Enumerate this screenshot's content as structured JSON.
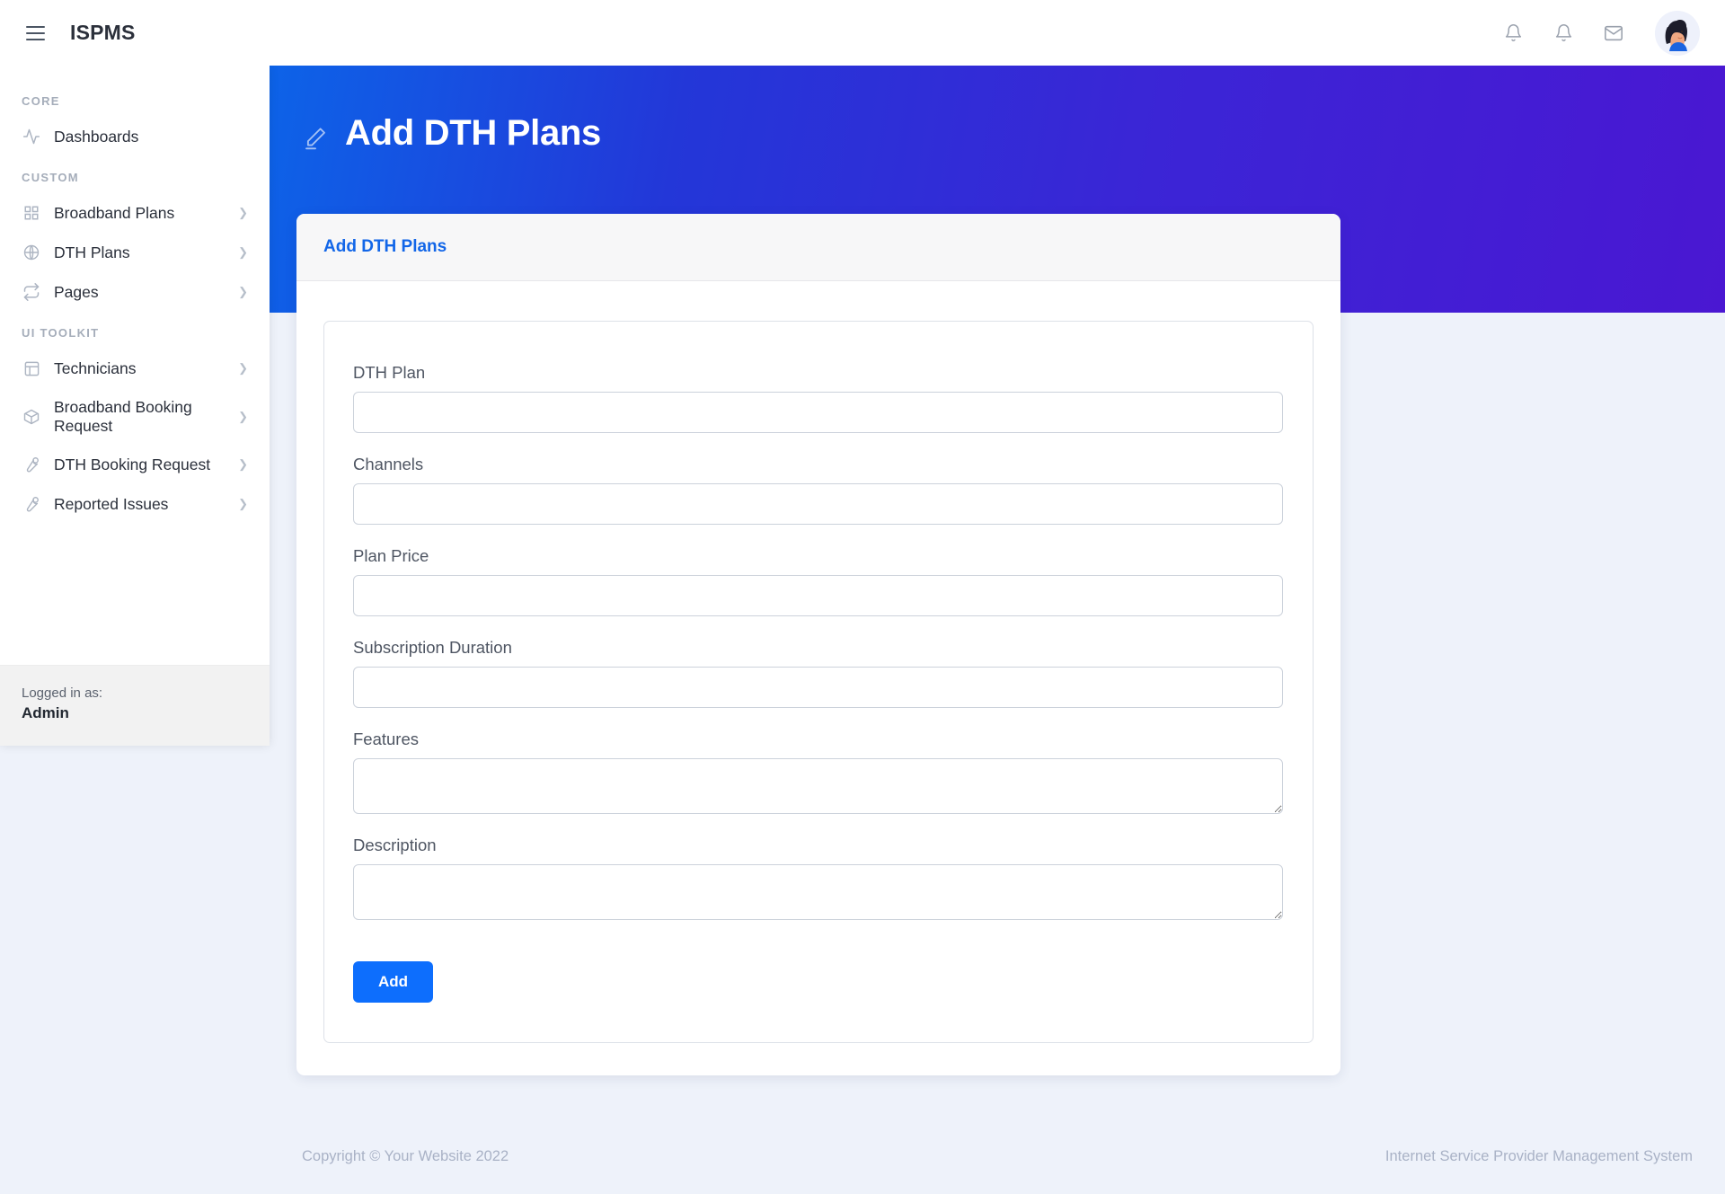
{
  "topbar": {
    "brand": "ISPMS",
    "menu_icon": "hamburger-icon",
    "icons": [
      {
        "name": "bell-icon",
        "label": "Alerts"
      },
      {
        "name": "bell-icon",
        "label": "Notifications"
      },
      {
        "name": "envelope-icon",
        "label": "Messages"
      }
    ],
    "avatar_alt": "User avatar"
  },
  "sidebar": {
    "sections": [
      {
        "heading": "CORE",
        "items": [
          {
            "label": "Dashboards",
            "icon": "activity-icon",
            "chevron": false
          }
        ]
      },
      {
        "heading": "CUSTOM",
        "items": [
          {
            "label": "Broadband Plans",
            "icon": "grid-icon",
            "chevron": true
          },
          {
            "label": "DTH Plans",
            "icon": "globe-icon",
            "chevron": true
          },
          {
            "label": "Pages",
            "icon": "repeat-icon",
            "chevron": true
          }
        ]
      },
      {
        "heading": "UI TOOLKIT",
        "items": [
          {
            "label": "Technicians",
            "icon": "layout-icon",
            "chevron": true
          },
          {
            "label": "Broadband Booking Request",
            "icon": "box-icon",
            "chevron": true
          },
          {
            "label": "DTH Booking Request",
            "icon": "wrench-icon",
            "chevron": true
          },
          {
            "label": "Reported Issues",
            "icon": "wrench-icon",
            "chevron": true
          }
        ]
      }
    ],
    "footer": {
      "logged_in_label": "Logged in as:",
      "user": "Admin"
    }
  },
  "hero": {
    "title": "Add DTH Plans",
    "icon": "pencil-icon",
    "gradient_from": "#0d63e8",
    "gradient_to": "#4a17d2"
  },
  "card": {
    "header": "Add DTH Plans",
    "fields": [
      {
        "label": "DTH Plan",
        "value": "",
        "placeholder": "",
        "type": "text",
        "name": "dth-plan"
      },
      {
        "label": "Channels",
        "value": "",
        "placeholder": "",
        "type": "text",
        "name": "channels"
      },
      {
        "label": "Plan Price",
        "value": "",
        "placeholder": "",
        "type": "text",
        "name": "plan-price"
      },
      {
        "label": "Subscription Duration",
        "value": "",
        "placeholder": "",
        "type": "text",
        "name": "subscription-duration"
      },
      {
        "label": "Features",
        "value": "",
        "placeholder": "",
        "type": "textarea",
        "name": "features"
      },
      {
        "label": "Description",
        "value": "",
        "placeholder": "",
        "type": "textarea",
        "name": "description"
      }
    ],
    "submit_label": "Add",
    "accent_color": "#0d6efd"
  },
  "footer": {
    "copyright": "Copyright © Your Website 2022",
    "system_name": "Internet Service Provider Management System"
  }
}
